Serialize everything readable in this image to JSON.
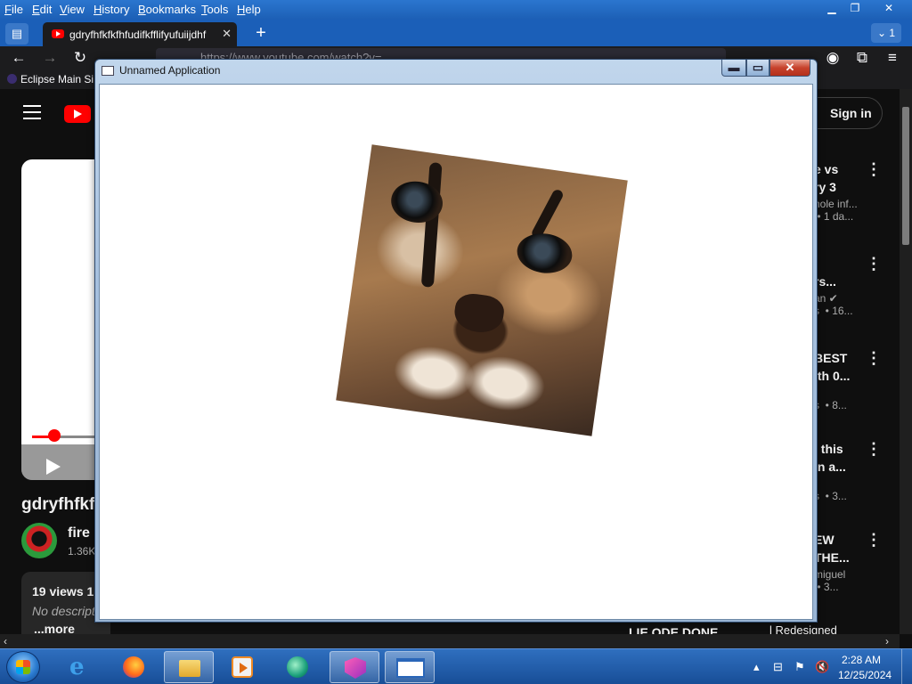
{
  "browser": {
    "menu": [
      "File",
      "Edit",
      "View",
      "History",
      "Bookmarks",
      "Tools",
      "Help"
    ],
    "window_controls": {
      "minimize": "▁",
      "restore": "❐",
      "close": "✕"
    },
    "tab": {
      "title": "gdryfhfkfkfhfudifkfflifyufuiijdhf",
      "close": "✕"
    },
    "new_tab": "+",
    "tab_list": "⌄ 1",
    "nav": {
      "back": "←",
      "forward": "→",
      "reload": "↻"
    },
    "url": "https://www.youtube.com/watch?v=...",
    "bookmark": "Eclipse Main Si",
    "toolbar_icons": {
      "account": "◉",
      "extensions": "⧉",
      "menu": "≡"
    }
  },
  "youtube": {
    "sign_in": "Sign in",
    "video_title": "gdryfhfkf",
    "channel_name": "fire",
    "channel_subs": "1.36K",
    "views": "19 views  1",
    "description": "No descript",
    "more": "...more",
    "progress": 0.22,
    "recommendations": [
      {
        "title": "e vs\nry 3",
        "meta": "hole inf...\n • 1 da..."
      },
      {
        "title": "\nrs...",
        "meta": "an ✔\ns  • 16..."
      },
      {
        "title": "BEST\nith 0...",
        "meta": "\ns  • 8..."
      },
      {
        "title": "l this\nin a...",
        "meta": "\ns  • 3..."
      },
      {
        "title": "EW\nTHE...",
        "meta": "miguel\n • 3..."
      }
    ],
    "bottom_label": "LIE ODE DONE",
    "bottom_label2": "l Redesigned"
  },
  "app_window": {
    "title": "Unnamed Application",
    "controls": {
      "minimize": "▬",
      "maximize": "▭",
      "close": "✕"
    },
    "image_label": "Cat face image"
  },
  "taskbar": {
    "items": [
      "Internet Explorer",
      "Firefox",
      "File Explorer",
      "Media Player",
      "Tool",
      "App",
      "Unnamed Application"
    ],
    "time": "2:28 AM",
    "date": "12/25/2024",
    "tray_icons": [
      "▴",
      "⊟",
      "⚑",
      "🔇"
    ]
  }
}
